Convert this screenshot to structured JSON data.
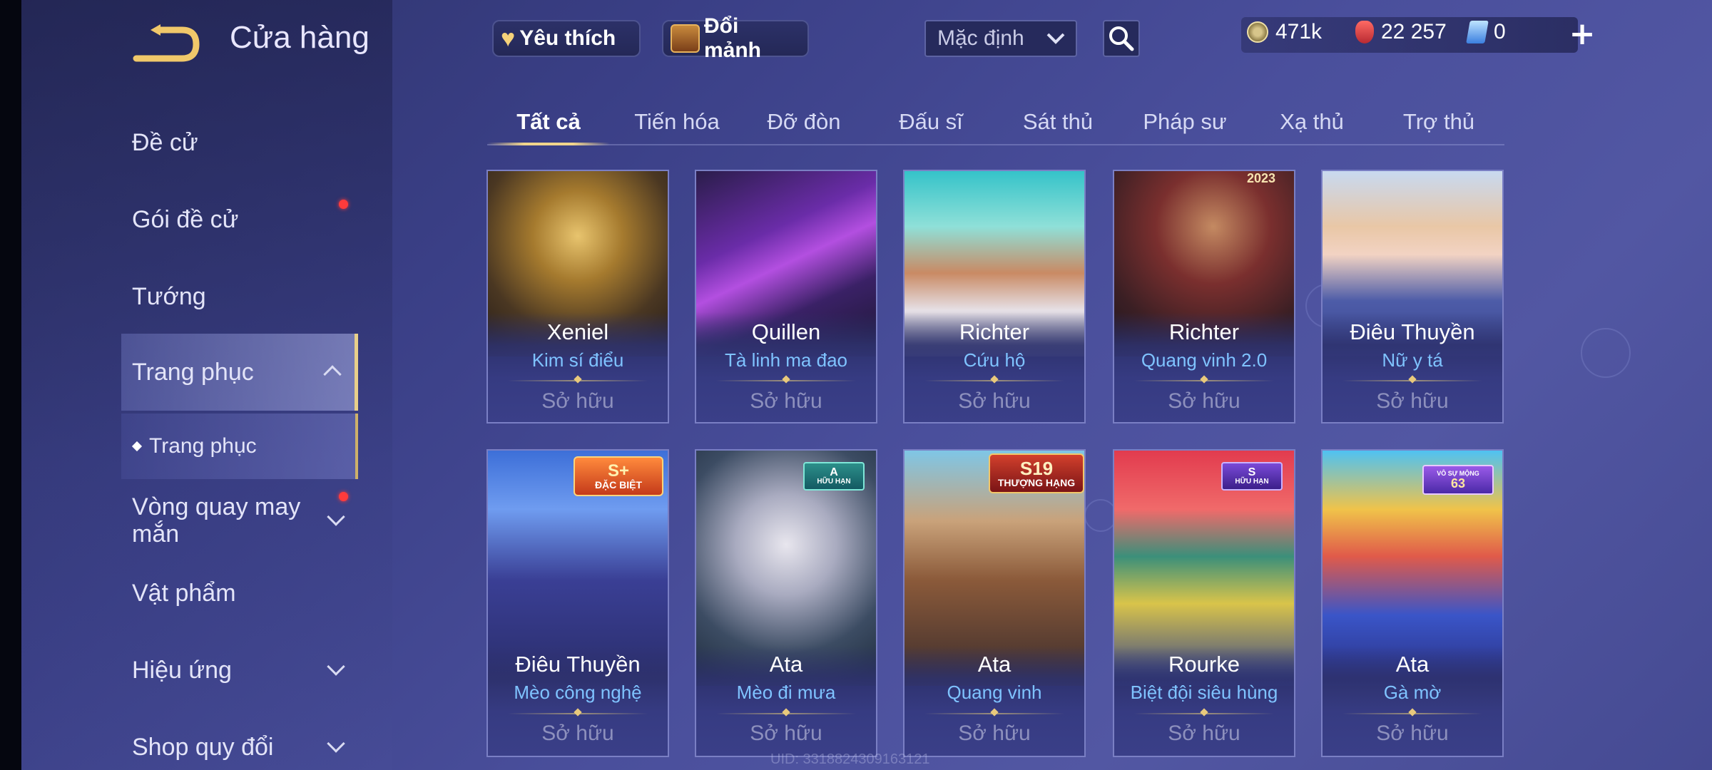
{
  "header": {
    "title": "Cửa hàng",
    "favorite_label": "Yêu thích",
    "shards_label": "Đổi mảnh",
    "sort_selected": "Mặc định"
  },
  "currencies": {
    "gold": "471k",
    "vouchers": "22 257",
    "gems": "0"
  },
  "sidebar": {
    "items": [
      {
        "label": "Đề cử"
      },
      {
        "label": "Gói đề cử"
      },
      {
        "label": "Tướng"
      },
      {
        "label": "Trang phục"
      },
      {
        "label": "Trang phục"
      },
      {
        "label": "Vòng quay may mắn"
      },
      {
        "label": "Vật phẩm"
      },
      {
        "label": "Hiệu ứng"
      },
      {
        "label": "Shop quy đổi"
      }
    ]
  },
  "tabs": [
    "Tất cả",
    "Tiến hóa",
    "Đỡ đòn",
    "Đấu sĩ",
    "Sát thủ",
    "Pháp sư",
    "Xạ thủ",
    "Trợ thủ"
  ],
  "owned_label": "Sở hữu",
  "skins": [
    {
      "hero": "Xeniel",
      "skin": "Kim sí điểu",
      "badge": null
    },
    {
      "hero": "Quillen",
      "skin": "Tà linh ma đao",
      "badge": null
    },
    {
      "hero": "Richter",
      "skin": "Cứu hộ",
      "badge": null
    },
    {
      "hero": "Richter",
      "skin": "Quang vinh 2.0",
      "badge": "2023"
    },
    {
      "hero": "Điêu Thuyền",
      "skin": "Nữ y tá",
      "badge": null
    },
    {
      "hero": "Điêu Thuyền",
      "skin": "Mèo công nghệ",
      "badge": "S+",
      "badge_sub": "ĐẶC BIỆT"
    },
    {
      "hero": "Ata",
      "skin": "Mèo đi mưa",
      "badge": "A",
      "badge_sub": "HỮU HẠN"
    },
    {
      "hero": "Ata",
      "skin": "Quang vinh",
      "badge": "S19",
      "badge_sub": "THƯỢNG HẠNG"
    },
    {
      "hero": "Rourke",
      "skin": "Biệt đội siêu hùng",
      "badge": "S",
      "badge_sub": "HỮU HẠN"
    },
    {
      "hero": "Ata",
      "skin": "Gà mờ",
      "badge": "63",
      "badge_sub": "VÔ SỰ MỘNG"
    }
  ],
  "uid": "UID: 3318824309163121",
  "colors": {
    "accent_gold": "#f1d58c",
    "skin_name_blue": "#7fc3ff",
    "owned_gray": "#8d90bd",
    "notification_red": "#ff3b3b"
  }
}
